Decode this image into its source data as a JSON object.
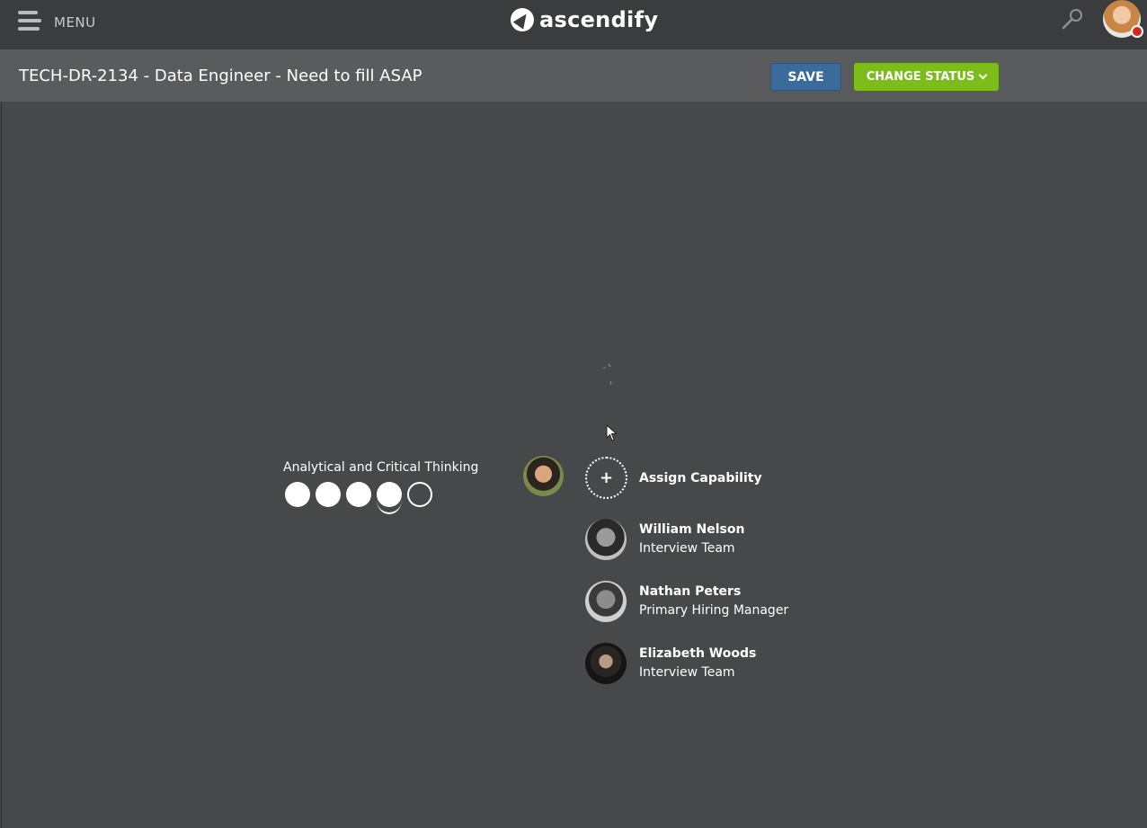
{
  "header": {
    "menu_label": "MENU",
    "logo_text": "ascendify"
  },
  "subheader": {
    "title": "TECH-DR-2134 - Data Engineer - Need to fill ASAP",
    "save_label": "SAVE",
    "change_status_label": "CHANGE STATUS"
  },
  "capability": {
    "name": "Analytical and Critical Thinking",
    "rating": 4,
    "rating_max": 5
  },
  "assign": {
    "label": "Assign Capability",
    "icon": "+"
  },
  "people": [
    {
      "name": "William Nelson",
      "role": "Interview Team"
    },
    {
      "name": "Nathan Peters",
      "role": "Primary Hiring Manager"
    },
    {
      "name": "Elizabeth Woods",
      "role": "Interview Team"
    }
  ],
  "colors": {
    "background": "#464748",
    "topbar": "#3b3c3d",
    "subheader": "#5a5b5c",
    "save_button": "#3a6b9b",
    "status_button": "#7dbd1b",
    "notification": "#d7261e"
  }
}
